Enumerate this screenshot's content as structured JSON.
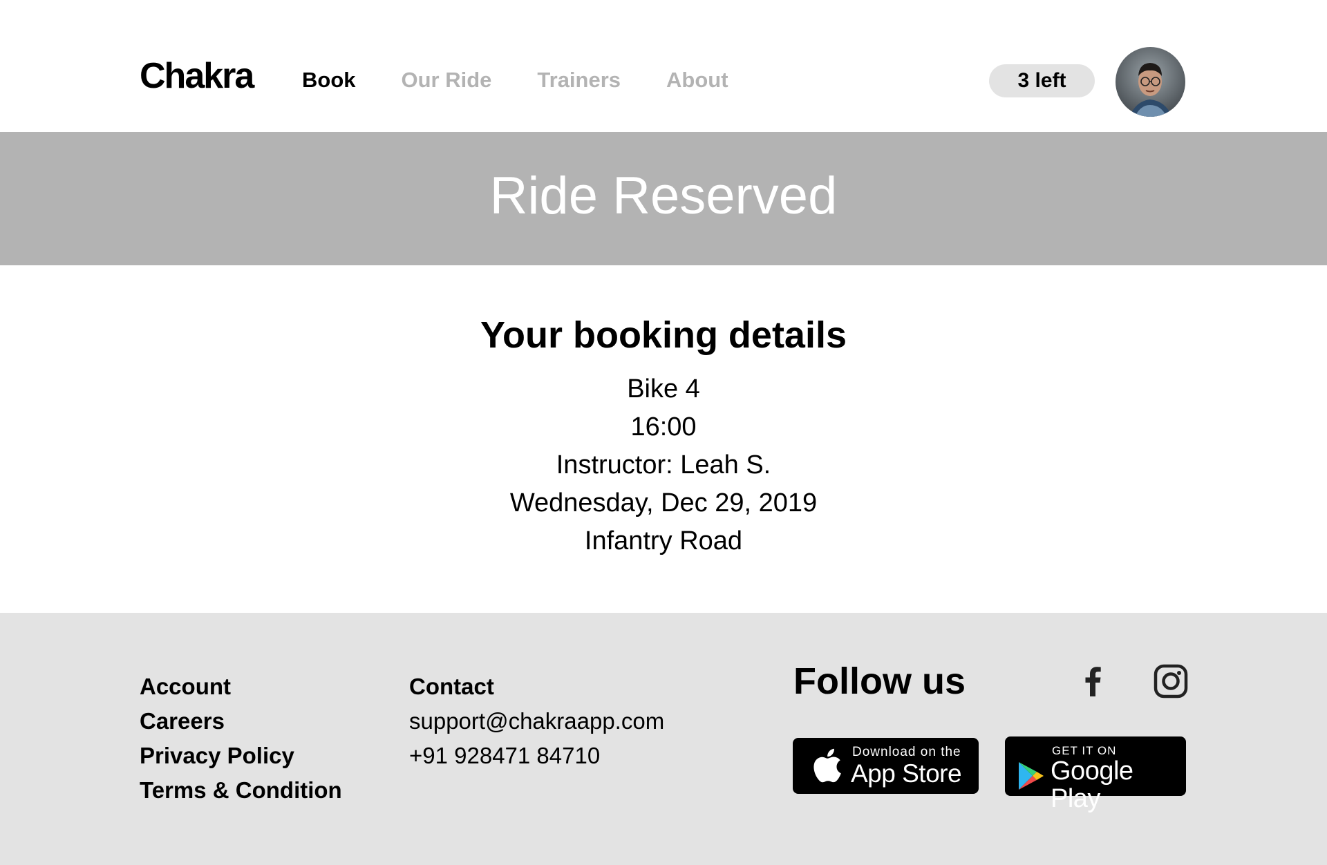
{
  "header": {
    "logo": "Chakra",
    "nav": [
      {
        "label": "Book",
        "active": true
      },
      {
        "label": "Our Ride",
        "active": false
      },
      {
        "label": "Trainers",
        "active": false
      },
      {
        "label": "About",
        "active": false
      }
    ],
    "credits_label": "3 left"
  },
  "hero": {
    "title": "Ride Reserved"
  },
  "booking": {
    "title": "Your booking details",
    "bike": "Bike 4",
    "time": "16:00",
    "instructor": "Instructor: Leah S.",
    "date": "Wednesday, Dec 29, 2019",
    "location": "Infantry Road"
  },
  "footer": {
    "account_links": [
      "Account",
      "Careers",
      "Privacy Policy",
      "Terms & Condition"
    ],
    "contact": {
      "heading": "Contact",
      "email": "support@chakraapp.com",
      "phone": "+91 928471 84710"
    },
    "follow_heading": "Follow us",
    "social_icons": [
      "facebook-icon",
      "instagram-icon"
    ],
    "app_store": {
      "small": "Download on the",
      "big": "App Store"
    },
    "google_play": {
      "small": "GET IT ON",
      "big": "Google Play"
    }
  },
  "colors": {
    "hero_bg": "#b3b3b3",
    "footer_bg": "#e3e3e3",
    "nav_inactive": "#b3b3b3",
    "credits_bg": "#e3e3e3"
  }
}
